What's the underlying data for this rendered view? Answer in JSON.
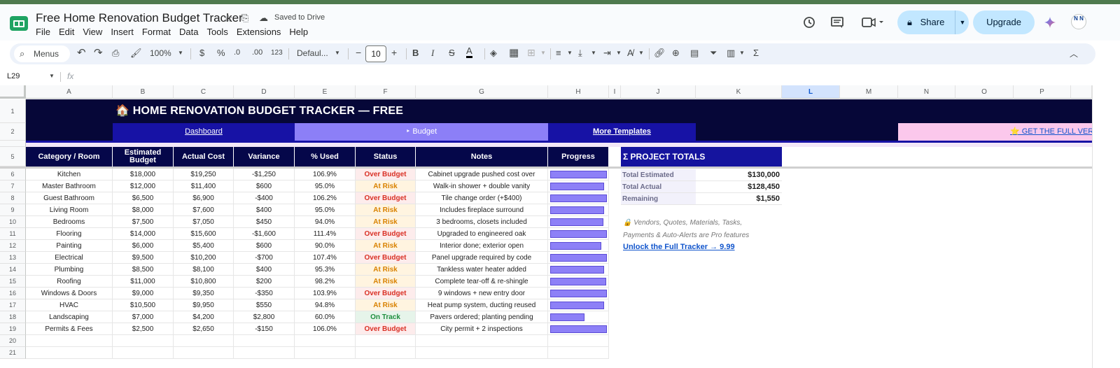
{
  "app": {
    "doc_title": "Free Home Renovation Budget Tracker",
    "saved_status": "Saved to Drive",
    "menu": [
      "File",
      "Edit",
      "View",
      "Insert",
      "Format",
      "Data",
      "Tools",
      "Extensions",
      "Help"
    ],
    "share_label": "Share",
    "upgrade_label": "Upgrade",
    "avatar_initials": "N N"
  },
  "toolbar": {
    "menus_label": "Menus",
    "zoom": "100%",
    "currency": "$",
    "percent": "%",
    "dec_decrease": ".0",
    "dec_increase": ".00",
    "number_format": "123",
    "font_name": "Defaul...",
    "font_size": "10",
    "minus": "−",
    "plus": "+",
    "bold": "B",
    "italic": "I",
    "strike": "S",
    "text_color": "A",
    "sigma": "Σ"
  },
  "formula_bar": {
    "name_box": "L29",
    "fx": "fx"
  },
  "columns": [
    "A",
    "B",
    "C",
    "D",
    "E",
    "F",
    "G",
    "H",
    "I",
    "J",
    "K",
    "L",
    "M",
    "N",
    "O",
    "P"
  ],
  "selected_column": "L",
  "row_numbers": [
    "1",
    "2",
    "5",
    "6",
    "7",
    "8",
    "9",
    "10",
    "11",
    "12",
    "13",
    "14",
    "15",
    "16",
    "17",
    "18",
    "19",
    "20",
    "21"
  ],
  "sheet": {
    "banner_title": "🏠 HOME RENOVATION BUDGET TRACKER  —  FREE",
    "nav": {
      "dashboard": "Dashboard",
      "budget": "‣ Budget",
      "more_templates": "More Templates",
      "get_full": "⭐ GET THE FULL VERSI"
    },
    "headers": {
      "category": "Category / Room",
      "estimated": "Estimated Budget",
      "actual": "Actual Cost",
      "variance": "Variance",
      "used": "% Used",
      "status": "Status",
      "notes": "Notes",
      "progress": "Progress"
    },
    "rows": [
      {
        "category": "Kitchen",
        "estimated": "$18,000",
        "actual": "$19,250",
        "variance": "-$1,250",
        "used": "106.9%",
        "status": "Over Budget",
        "notes": "Cabinet upgrade pushed cost over",
        "progress": 1.0
      },
      {
        "category": "Master Bathroom",
        "estimated": "$12,000",
        "actual": "$11,400",
        "variance": "$600",
        "used": "95.0%",
        "status": "At Risk",
        "notes": "Walk-in shower + double vanity",
        "progress": 0.95
      },
      {
        "category": "Guest Bathroom",
        "estimated": "$6,500",
        "actual": "$6,900",
        "variance": "-$400",
        "used": "106.2%",
        "status": "Over Budget",
        "notes": "Tile change order (+$400)",
        "progress": 1.0
      },
      {
        "category": "Living Room",
        "estimated": "$8,000",
        "actual": "$7,600",
        "variance": "$400",
        "used": "95.0%",
        "status": "At Risk",
        "notes": "Includes fireplace surround",
        "progress": 0.95
      },
      {
        "category": "Bedrooms",
        "estimated": "$7,500",
        "actual": "$7,050",
        "variance": "$450",
        "used": "94.0%",
        "status": "At Risk",
        "notes": "3 bedrooms, closets included",
        "progress": 0.94
      },
      {
        "category": "Flooring",
        "estimated": "$14,000",
        "actual": "$15,600",
        "variance": "-$1,600",
        "used": "111.4%",
        "status": "Over Budget",
        "notes": "Upgraded to engineered oak",
        "progress": 1.0
      },
      {
        "category": "Painting",
        "estimated": "$6,000",
        "actual": "$5,400",
        "variance": "$600",
        "used": "90.0%",
        "status": "At Risk",
        "notes": "Interior done; exterior open",
        "progress": 0.9
      },
      {
        "category": "Electrical",
        "estimated": "$9,500",
        "actual": "$10,200",
        "variance": "-$700",
        "used": "107.4%",
        "status": "Over Budget",
        "notes": "Panel upgrade required by code",
        "progress": 1.0
      },
      {
        "category": "Plumbing",
        "estimated": "$8,500",
        "actual": "$8,100",
        "variance": "$400",
        "used": "95.3%",
        "status": "At Risk",
        "notes": "Tankless water heater added",
        "progress": 0.953
      },
      {
        "category": "Roofing",
        "estimated": "$11,000",
        "actual": "$10,800",
        "variance": "$200",
        "used": "98.2%",
        "status": "At Risk",
        "notes": "Complete tear-off & re-shingle",
        "progress": 0.982
      },
      {
        "category": "Windows & Doors",
        "estimated": "$9,000",
        "actual": "$9,350",
        "variance": "-$350",
        "used": "103.9%",
        "status": "Over Budget",
        "notes": "9 windows + new entry door",
        "progress": 1.0
      },
      {
        "category": "HVAC",
        "estimated": "$10,500",
        "actual": "$9,950",
        "variance": "$550",
        "used": "94.8%",
        "status": "At Risk",
        "notes": "Heat pump system, ducting reused",
        "progress": 0.948
      },
      {
        "category": "Landscaping",
        "estimated": "$7,000",
        "actual": "$4,200",
        "variance": "$2,800",
        "used": "60.0%",
        "status": "On Track",
        "notes": "Pavers ordered; planting pending",
        "progress": 0.6
      },
      {
        "category": "Permits & Fees",
        "estimated": "$2,500",
        "actual": "$2,650",
        "variance": "-$150",
        "used": "106.0%",
        "status": "Over Budget",
        "notes": "City permit + 2 inspections",
        "progress": 1.0
      }
    ],
    "totals": {
      "title": "Σ PROJECT TOTALS",
      "estimated_label": "Total Estimated",
      "estimated_value": "$130,000",
      "actual_label": "Total Actual",
      "actual_value": "$128,450",
      "remaining_label": "Remaining",
      "remaining_value": "$1,550"
    },
    "pro_note_line1": "🔒 Vendors, Quotes, Materials, Tasks,",
    "pro_note_line2": "Payments & Auto-Alerts are Pro features",
    "unlock_link": "Unlock the Full Tracker → 9.99"
  },
  "colors": {
    "banner": "#060738",
    "header": "#05074a",
    "totals_header": "#15149e",
    "progress_bar": "#8d80f7",
    "over_budget": "#d93025",
    "at_risk": "#d98200",
    "on_track": "#1e8e3e"
  }
}
